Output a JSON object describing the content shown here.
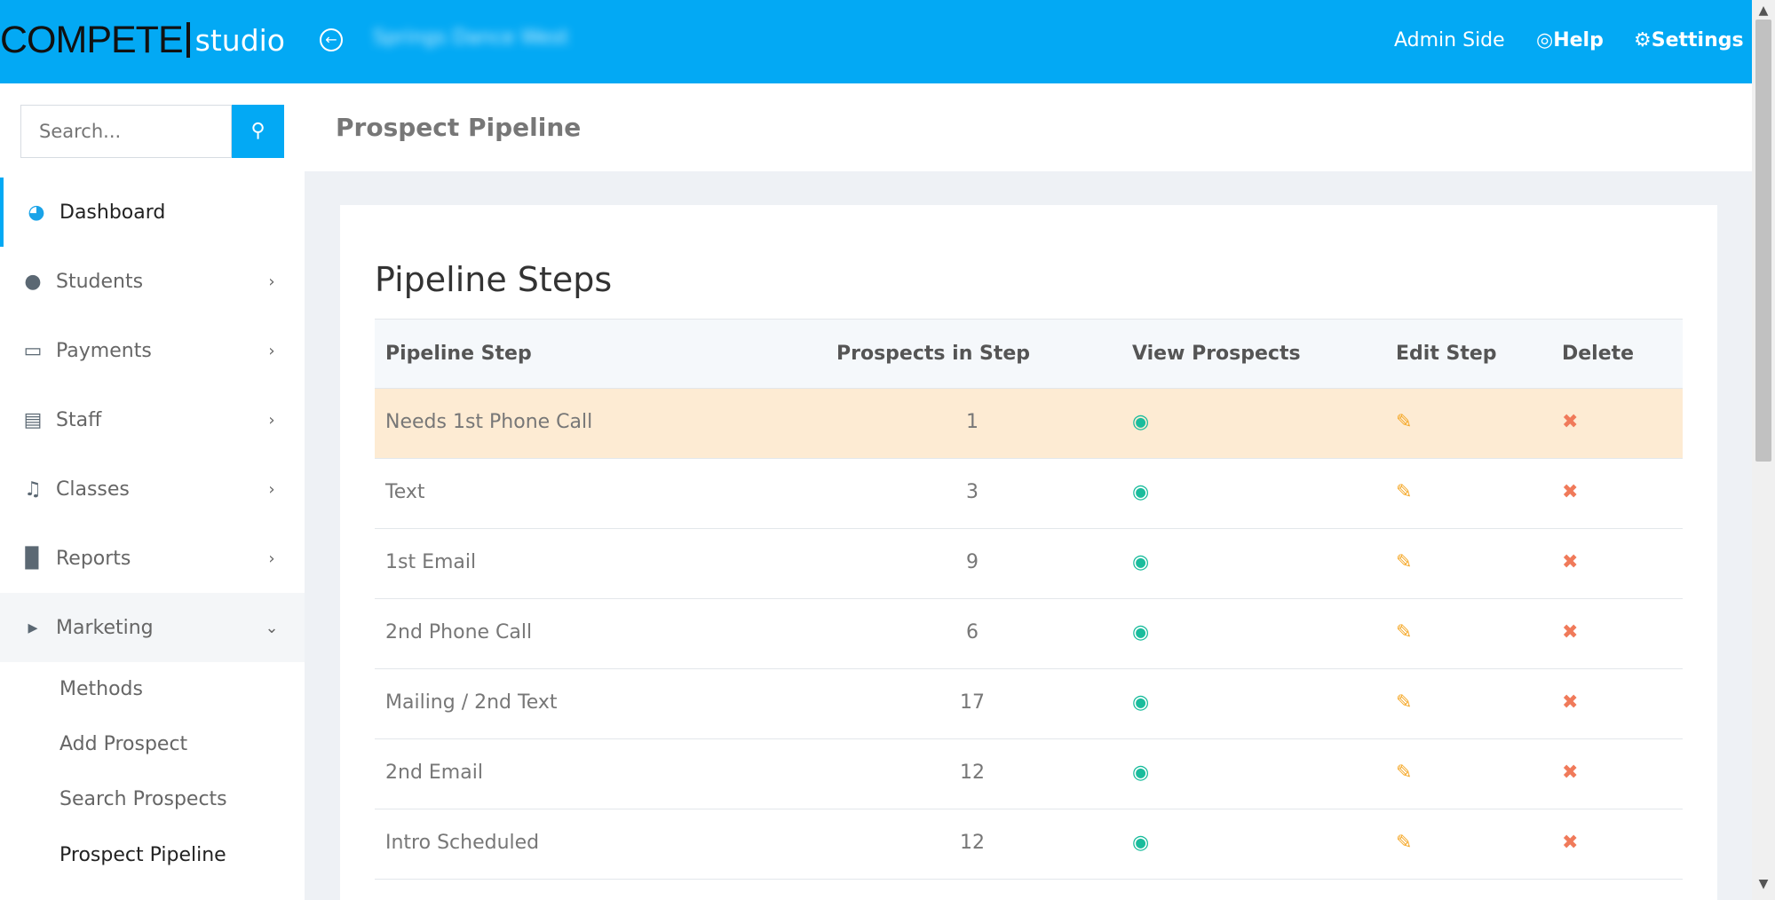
{
  "header": {
    "logo_main": "COMPETE",
    "logo_sub": "studio",
    "studio_name": "Springs Dance West",
    "admin_link": "Admin Side",
    "help_link": "Help",
    "settings_link": "Settings",
    "brand_color": "#03a9f4"
  },
  "sidebar": {
    "search_placeholder": "Search...",
    "items": [
      {
        "label": "Dashboard",
        "icon": "dashboard-icon"
      },
      {
        "label": "Students",
        "icon": "users-icon"
      },
      {
        "label": "Payments",
        "icon": "credit-card-icon"
      },
      {
        "label": "Staff",
        "icon": "sitemap-icon"
      },
      {
        "label": "Classes",
        "icon": "bell-icon"
      },
      {
        "label": "Reports",
        "icon": "bar-chart-icon"
      },
      {
        "label": "Marketing",
        "icon": "megaphone-icon"
      }
    ],
    "marketing_sub": [
      "Methods",
      "Add Prospect",
      "Search Prospects",
      "Prospect Pipeline"
    ]
  },
  "page": {
    "title": "Prospect Pipeline",
    "card_title": "Pipeline Steps"
  },
  "table": {
    "headers": [
      "Pipeline Step",
      "Prospects in Step",
      "View Prospects",
      "Edit Step",
      "Delete"
    ],
    "rows": [
      {
        "step": "Needs 1st Phone Call",
        "count": "1"
      },
      {
        "step": "Text",
        "count": "3"
      },
      {
        "step": "1st Email",
        "count": "9"
      },
      {
        "step": "2nd Phone Call",
        "count": "6"
      },
      {
        "step": "Mailing / 2nd Text",
        "count": "17"
      },
      {
        "step": "2nd Email",
        "count": "12"
      },
      {
        "step": "Intro Scheduled",
        "count": "12"
      }
    ]
  }
}
